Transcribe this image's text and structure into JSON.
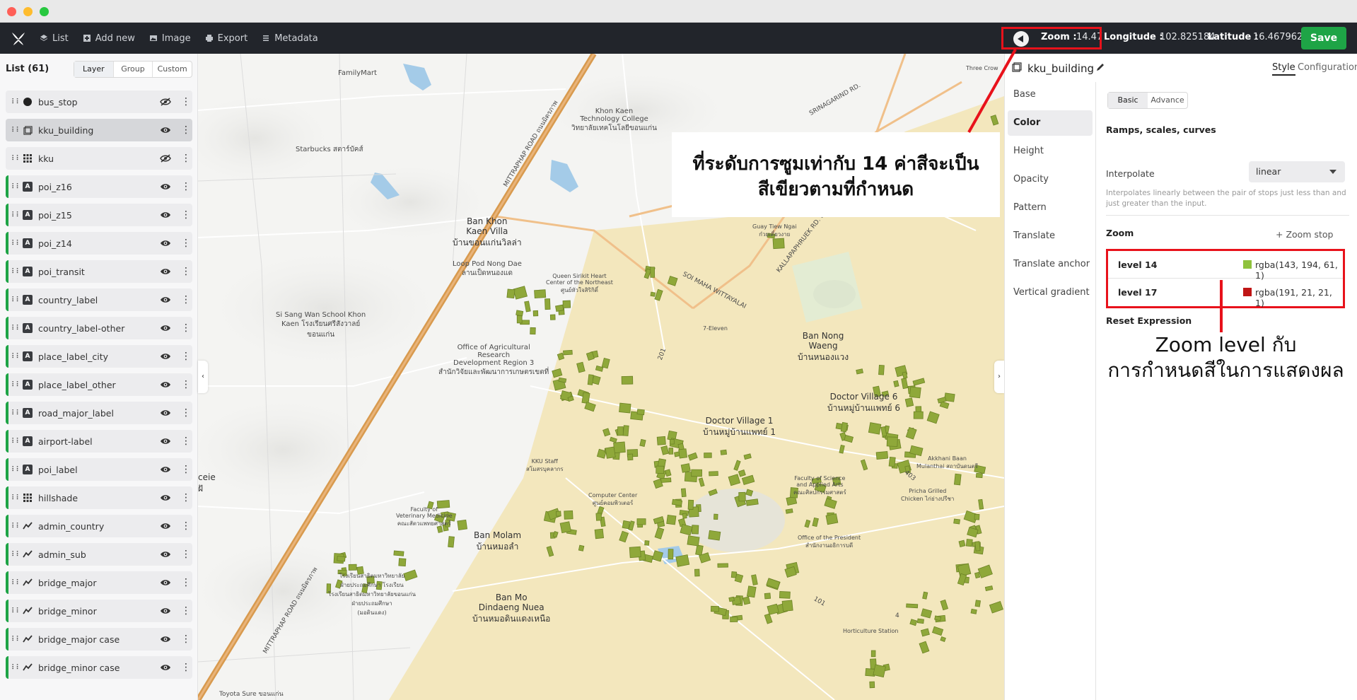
{
  "toolbar": {
    "menu": [
      {
        "label": "List",
        "icon": "layers-icon"
      },
      {
        "label": "Add new",
        "icon": "plus-square-icon"
      },
      {
        "label": "Image",
        "icon": "image-icon"
      },
      {
        "label": "Export",
        "icon": "printer-icon"
      },
      {
        "label": "Metadata",
        "icon": "list-icon"
      }
    ],
    "zoom_label": "Zoom :",
    "zoom_value": "14.47",
    "lon_label": "Longitude :",
    "lon_value": "102.825184",
    "lat_label": "Latitude :",
    "lat_value": "16.467962",
    "save_label": "Save",
    "accent": "#1ea446",
    "highlight": "#e8121b"
  },
  "sidebar": {
    "title": "List (61)",
    "tabs": [
      "Layer",
      "Group",
      "Custom"
    ],
    "active_tab": "Layer",
    "layers": [
      {
        "name": "bus_stop",
        "type": "circle",
        "visible": false
      },
      {
        "name": "kku_building",
        "type": "fill-extrusion",
        "visible": true,
        "selected": true
      },
      {
        "name": "kku",
        "type": "raster",
        "visible": false
      },
      {
        "name": "poi_z16",
        "type": "symbol",
        "visible": true
      },
      {
        "name": "poi_z15",
        "type": "symbol",
        "visible": true
      },
      {
        "name": "poi_z14",
        "type": "symbol",
        "visible": true
      },
      {
        "name": "poi_transit",
        "type": "symbol",
        "visible": true
      },
      {
        "name": "country_label",
        "type": "symbol",
        "visible": true
      },
      {
        "name": "country_label-other",
        "type": "symbol",
        "visible": true
      },
      {
        "name": "place_label_city",
        "type": "symbol",
        "visible": true
      },
      {
        "name": "place_label_other",
        "type": "symbol",
        "visible": true
      },
      {
        "name": "road_major_label",
        "type": "symbol",
        "visible": true
      },
      {
        "name": "airport-label",
        "type": "symbol",
        "visible": true
      },
      {
        "name": "poi_label",
        "type": "symbol",
        "visible": true
      },
      {
        "name": "hillshade",
        "type": "raster",
        "visible": true
      },
      {
        "name": "admin_country",
        "type": "line",
        "visible": true
      },
      {
        "name": "admin_sub",
        "type": "line",
        "visible": true
      },
      {
        "name": "bridge_major",
        "type": "line",
        "visible": true
      },
      {
        "name": "bridge_minor",
        "type": "line",
        "visible": true
      },
      {
        "name": "bridge_major case",
        "type": "line",
        "visible": true
      },
      {
        "name": "bridge_minor case",
        "type": "line",
        "visible": true
      }
    ]
  },
  "map": {
    "labels": {
      "familymart": "FamilyMart",
      "starbucks": "Starbucks สตาร์บัคส์",
      "ban_khon_kaen_villa": "Ban Khon\nKaen Villa\nบ้านขอนแก่นวิลล่า",
      "loop_pod": "Loop Pod Nong Dae\nลานเป็ดหนองแด",
      "si_sang": "Si Sang Wan School Khon\nKaen โรงเรียนศรีสังวาลย์\nขอนแก่น",
      "office_agri": "Office of Agricultural\nResearch\nDevelopment Region 3\nสำนักวิจัยและพัฒนาการเกษตรเขตที่",
      "khon_kaen_tech": "Khon Kaen\nTechnology College\nวิทยาลัยเทคโนโลยีขอนแก่น",
      "queen_heart": "Queen Sirikit Heart\nCenter of the Northeast\nศูนย์หัวใจสิริกิติ์",
      "guay_tiew": "Guay Tiew Ngai\nก๋วยเตี๋ยวงาย",
      "ban_nong_waeng": "Ban Nong\nWaeng\nบ้านหนองแวง",
      "doctor_village_1": "Doctor Village 1\nบ้านหมู่บ้านแพทย์ 1",
      "doctor_village_6": "Doctor Village 6\nบ้านหมู่บ้านแพทย์ 6",
      "ban_molam": "Ban Molam\nบ้านหมอลำ",
      "ban_mo": "Ban Mo\nDindaeng Nuea\nบ้านหมอดินแดงเหนือ",
      "seven_eleven": "7-Eleven",
      "three_crow": "Three Crow",
      "kku_staff": "KKU Staff\nสโมสรบุคลากร",
      "computer_center": "Computer Center\nศูนย์คอมพิวเตอร์",
      "fac_science": "Faculty of Science\nand Applied Arts\nคณะศิลปกรรมศาสตร์",
      "office_of": "Office of the President\nสำนักงานอธิการบดี",
      "akkhani": "Akkhani Baan\nMulanthai สถาบันดนตรี",
      "pricha": "Pricha Grilled\nChicken ไก่ย่างปรีชา",
      "horticulture": "Horticulture Station",
      "toyota": "Toyota Sure ขอนแก่น",
      "vet_med": "Faculty of\nVeterinary Medicine\nคณะสัตวแพทยศาสตร์",
      "school_demo": "โรงเรียนสาธิตมหาวิทยาลัย\nฝ่ายประถมศึกษา โรงเรียน\nโรงเรียนสาธิตมหาวิทยาลัยขอนแก่น\nฝ่ายประถมศึกษา\n(มอดินแดง)",
      "road_mittraphap": "MITTRAPHAP ROAD ถนนมิตรภาพ",
      "road_mittraphap_s": "MITTRAPHAP ROAD ถนนมิตรภาพ",
      "road_maha_wittayalai": "SOI MAHA WITTAYALAI",
      "road_kallaphapruek": "KALLAPAPHRUEK RD. ถนนกัลปพฤกษ์",
      "road_srinagarind": "SRINAGARIND RD.",
      "num_201": "201",
      "num_403": "403",
      "num_101": "101",
      "num_4": "4",
      "edge_left": "ceie\nฝั"
    },
    "colors": {
      "base": "#f4f4f2",
      "campus": "#f3e7bd",
      "road_major": "#d89a4e",
      "road_minor": "#e9b47a",
      "building": "#8fa83a",
      "water": "#a4cbe8"
    }
  },
  "callouts": {
    "top_line1": "ที่ระดับการซูมเท่ากับ 14  ค่าสีจะเป็น",
    "top_line2": "สีเขียวตามที่กำหนด",
    "right_line1": "Zoom level กับ",
    "right_line2": "การกำหนดสีในการแสดงผล"
  },
  "panel": {
    "layer_name": "kku_building",
    "tabs": [
      "Style",
      "Configuration"
    ],
    "active_tab": "Style",
    "nav": [
      "Base",
      "Color",
      "Height",
      "Opacity",
      "Pattern",
      "Translate",
      "Translate anchor",
      "Vertical gradient"
    ],
    "active_nav": "Color",
    "mode_tabs": [
      "Basic",
      "Advance"
    ],
    "active_mode": "Basic",
    "ramps_title": "Ramps, scales, curves",
    "interpolate_label": "Interpolate",
    "interpolate_value": "linear",
    "interpolate_help": "Interpolates linearly between the pair of stops just less than and just greater than the input.",
    "zoom_title": "Zoom",
    "zoom_stop_label": "+ Zoom stop",
    "stops": [
      {
        "label": "level 14",
        "color": "#8fc23d",
        "value": "rgba(143, 194, 61, 1)"
      },
      {
        "label": "level 17",
        "color": "#bf1515",
        "value": "rgba(191, 21, 21, 1)"
      }
    ],
    "reset_label": "Reset Expression"
  }
}
